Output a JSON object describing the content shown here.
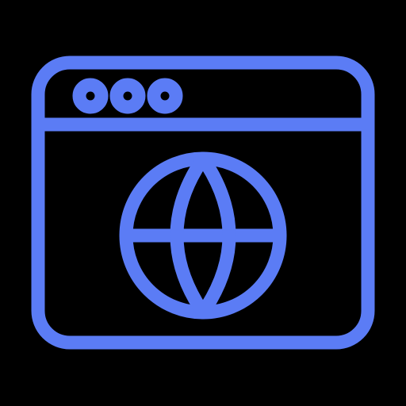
{
  "icon": {
    "name": "browser-window-globe-icon",
    "stroke_color": "#5B7CF5",
    "background_color": "#000000",
    "window_control_dots": 3
  }
}
